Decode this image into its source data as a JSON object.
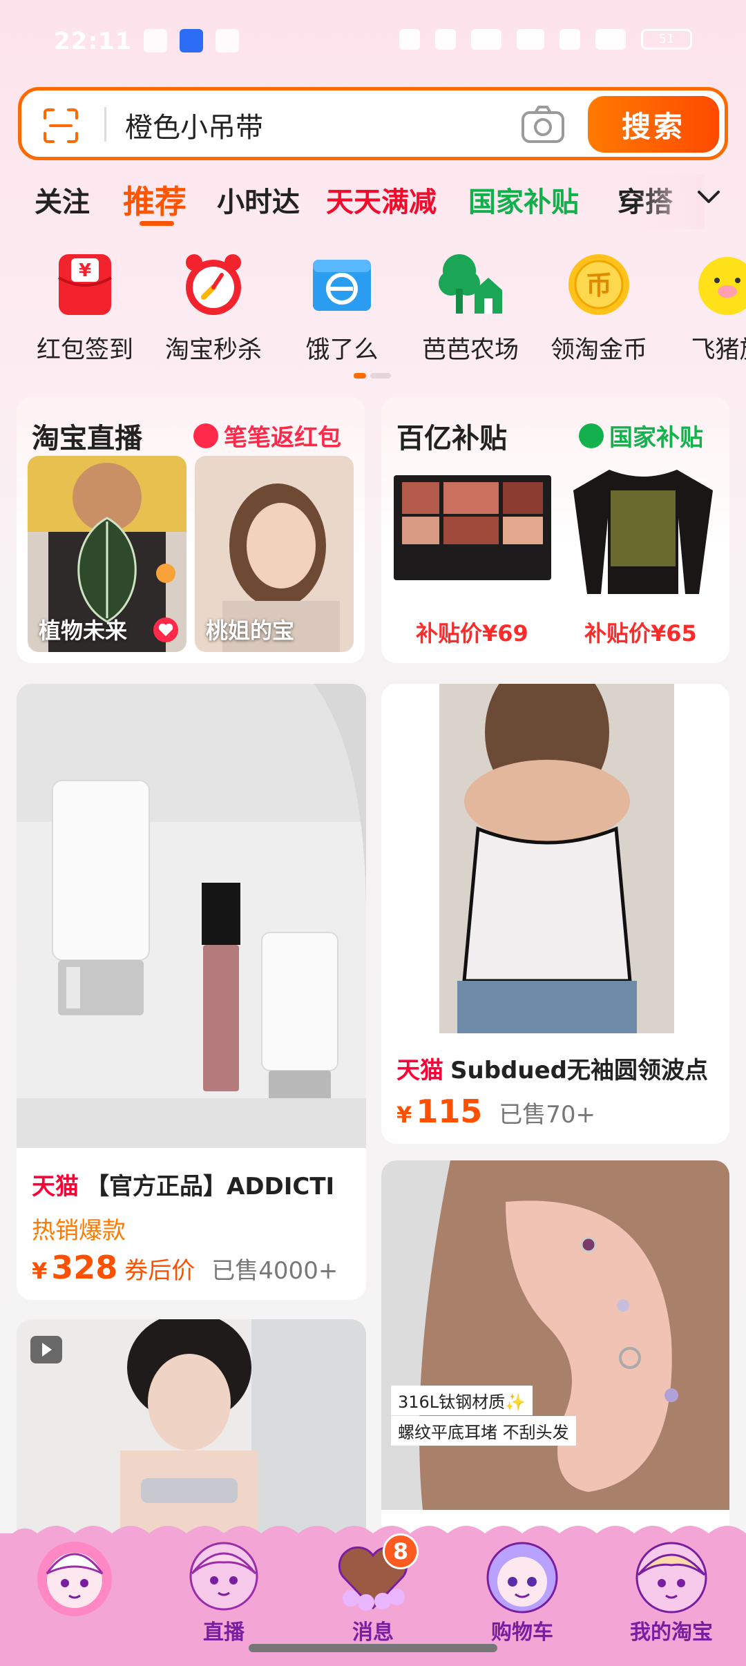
{
  "status_bar": {
    "time": "22:11",
    "battery": "51"
  },
  "search": {
    "value": "橙色小吊带",
    "button_label": "搜索"
  },
  "tabs": [
    "关注",
    "推荐",
    "小时达",
    "天天满减",
    "国家补贴",
    "穿搭"
  ],
  "shortcuts": [
    {
      "label": "红包签到",
      "icon": "red-envelope-icon"
    },
    {
      "label": "淘宝秒杀",
      "icon": "alarm-clock-icon"
    },
    {
      "label": "饿了么",
      "icon": "eleme-icon"
    },
    {
      "label": "芭芭农场",
      "icon": "tree-farm-icon"
    },
    {
      "label": "领淘金币",
      "icon": "gold-coin-icon"
    },
    {
      "label": "飞猪旅",
      "icon": "fliggy-pig-icon"
    }
  ],
  "promo_live": {
    "title": "淘宝直播",
    "subtitle": "笔笔返红包",
    "items": [
      {
        "label": "植物未来"
      },
      {
        "label": "桃姐的宝"
      }
    ]
  },
  "promo_subsidy": {
    "title": "百亿补贴",
    "subtitle": "国家补贴",
    "items": [
      {
        "price": "补贴价¥69"
      },
      {
        "price": "补贴价¥65"
      }
    ]
  },
  "product_1": {
    "store": "天猫",
    "title": "【官方正品】ADDICTI",
    "tag": "热销爆款",
    "currency": "¥",
    "price": "328",
    "price_note": "券后价",
    "sold": "已售4000+"
  },
  "product_2": {
    "store": "天猫",
    "title": "Subdued无袖圆领波点",
    "currency": "¥",
    "price": "115",
    "sold": "已售70+"
  },
  "product_4_overlay": {
    "line1": "316L钛钢材质✨",
    "line2": "螺纹平底耳堵 不刮头发"
  },
  "bottom_nav": {
    "items": [
      {
        "label": ""
      },
      {
        "label": "直播"
      },
      {
        "label": "消息",
        "badge": "8"
      },
      {
        "label": "购物车"
      },
      {
        "label": "我的淘宝"
      }
    ]
  },
  "colors": {
    "accent": "#ff5500",
    "tmall_red": "#ff0036",
    "subsidy_green": "#13b24f",
    "nav_pink": "#f3a6d6"
  }
}
